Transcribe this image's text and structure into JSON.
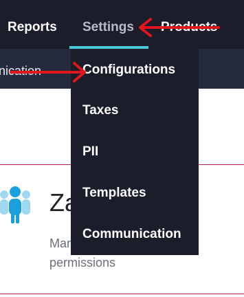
{
  "nav": {
    "items": [
      {
        "label": "Reports"
      },
      {
        "label": "Settings"
      },
      {
        "label": "Products"
      }
    ]
  },
  "subnav": {
    "partial_label": "Communication"
  },
  "dropdown": {
    "items": [
      {
        "label": "Configurations"
      },
      {
        "label": "Taxes"
      },
      {
        "label": "PII"
      },
      {
        "label": "Templates"
      },
      {
        "label": "Communication"
      }
    ]
  },
  "card": {
    "title": "Zapier",
    "description": "Manage users and groups permissions"
  },
  "colors": {
    "nav_bg": "#1b1d2b",
    "subnav_bg": "#262a3d",
    "accent": "#47c7d8",
    "divider": "#b51a4a",
    "annotation_arrow": "#e0161d"
  },
  "icons": {
    "card_icon": "users-group-icon"
  }
}
